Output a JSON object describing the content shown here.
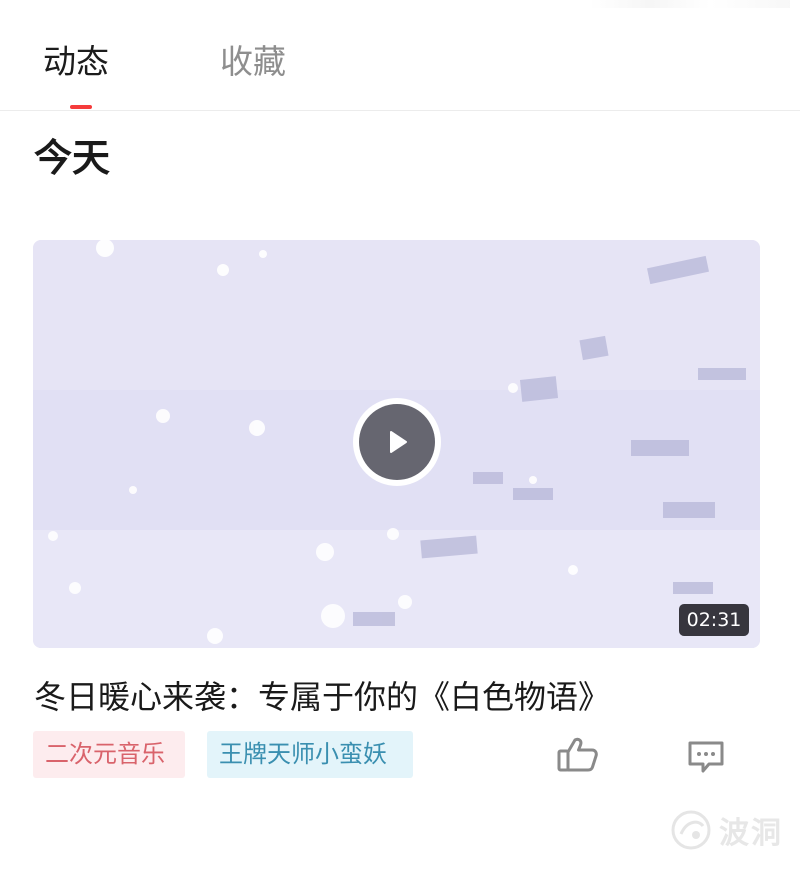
{
  "tabs": [
    {
      "label": "动态",
      "active": true
    },
    {
      "label": "收藏",
      "active": false
    }
  ],
  "colors": {
    "accent": "#f53b3b",
    "tag_pink_bg": "#fdecee",
    "tag_pink_text": "#d9636b",
    "tag_blue_bg": "#e3f4fa",
    "tag_blue_text": "#3a8fb0",
    "icon": "#8a8a8a"
  },
  "section": {
    "title": "今天"
  },
  "video": {
    "duration": "02:31",
    "title": "冬日暖心来袭：专属于你的《白色物语》",
    "play_icon": "play-icon"
  },
  "tags": [
    {
      "label": "二次元音乐",
      "style": "pink"
    },
    {
      "label": "王牌天师小蛮妖",
      "style": "blue"
    }
  ],
  "actions": {
    "like_icon": "thumbs-up-icon",
    "comment_icon": "comment-icon"
  },
  "watermark": {
    "text": "波洞",
    "logo_icon": "bodong-logo-icon"
  }
}
